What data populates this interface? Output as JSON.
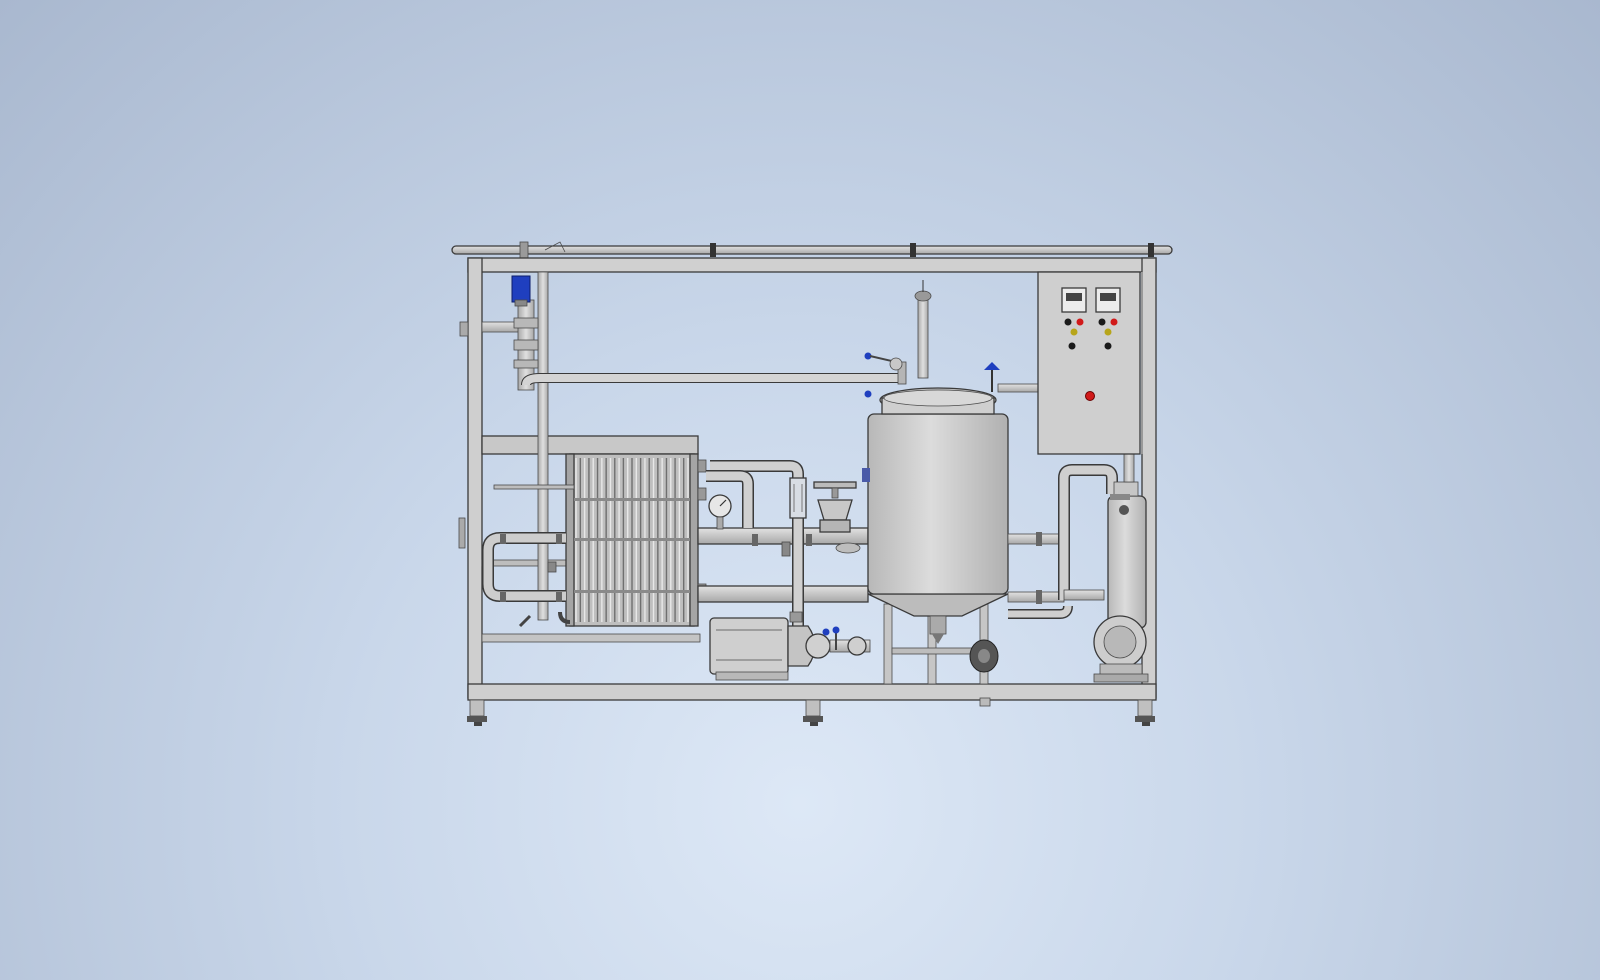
{
  "colors": {
    "background_center": "#dde8f6",
    "background_edge": "#a9b8cf",
    "steel": "#c8c8c8",
    "steel_light": "#d6d6d6",
    "steel_dark": "#9a9a9a",
    "outline": "#3a3a3a",
    "valve_blue": "#1f3fbf",
    "indicator_red": "#d11a1a",
    "indicator_yellow": "#b7a51a",
    "indicator_green": "#1a8a2a"
  },
  "components": {
    "control_cabinet": {
      "controllers": 2,
      "lamps": [
        "red",
        "yellow",
        "black",
        "red",
        "yellow",
        "black"
      ]
    },
    "heat_exchanger": {
      "plates": 26
    },
    "support_feet": 3
  }
}
